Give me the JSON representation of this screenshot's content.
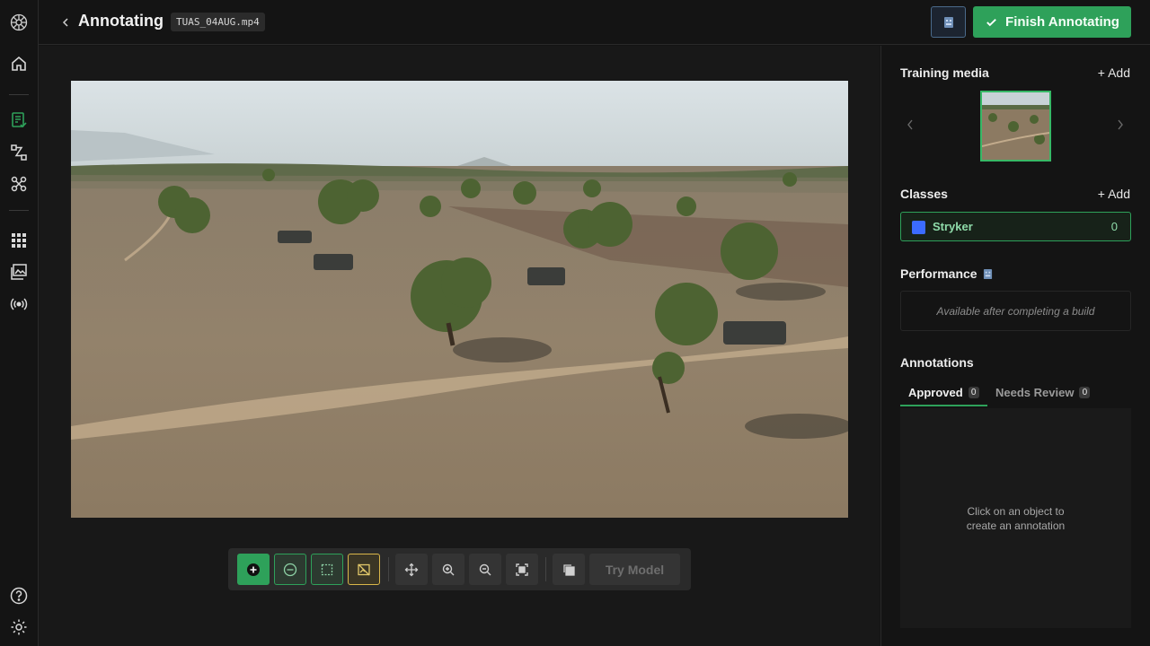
{
  "header": {
    "title": "Annotating",
    "file_name": "TUAS_04AUG.mp4",
    "finish_label": "Finish Annotating"
  },
  "rail": {
    "icons": [
      "logo-icon",
      "home-icon",
      "dataset-icon",
      "annotate-icon",
      "models-icon",
      "apps-icon",
      "gallery-icon",
      "stream-icon",
      "help-icon",
      "settings-icon"
    ]
  },
  "toolbar": {
    "try_model_label": "Try Model"
  },
  "panel": {
    "training_media": {
      "title": "Training media",
      "add_label": "+ Add"
    },
    "classes": {
      "title": "Classes",
      "add_label": "+ Add",
      "items": [
        {
          "name": "Stryker",
          "count": "0",
          "color": "#3b6bff"
        }
      ]
    },
    "performance": {
      "title": "Performance",
      "placeholder": "Available after completing a build"
    },
    "annotations": {
      "title": "Annotations",
      "tabs": [
        {
          "label": "Approved",
          "count": "0"
        },
        {
          "label": "Needs Review",
          "count": "0"
        }
      ],
      "empty_text": "Click on an object to create an annotation"
    }
  },
  "colors": {
    "accent": "#2ea15a",
    "class_color": "#3b6bff",
    "background": "#141414"
  }
}
